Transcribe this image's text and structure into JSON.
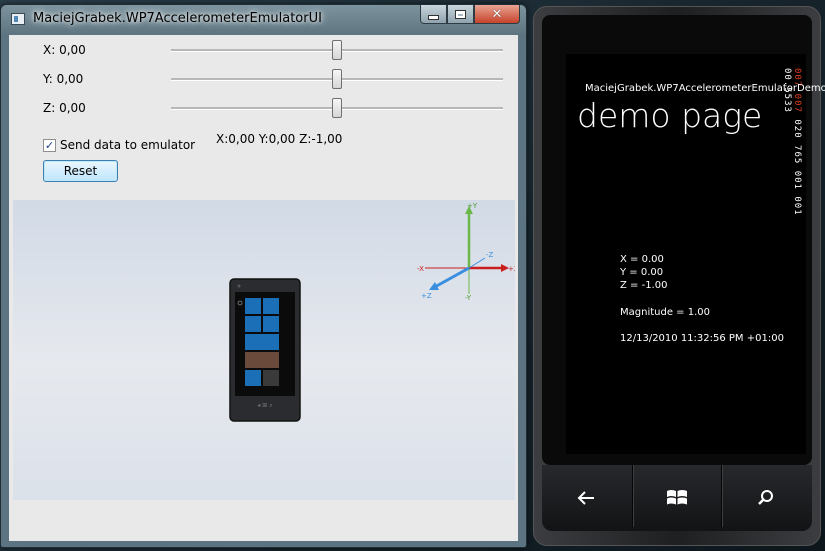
{
  "window": {
    "title": "MaciejGrabek.WP7AccelerometerEmulatorUI",
    "close_glyph": "✕",
    "icons": [
      "app-icon",
      "minimize-icon",
      "maximize-icon",
      "close-icon"
    ]
  },
  "sliders": [
    {
      "label": "X: 0,00",
      "value": 0.5
    },
    {
      "label": "Y: 0,00",
      "value": 0.5
    },
    {
      "label": "Z: 0,00",
      "value": 0.5
    }
  ],
  "send_checkbox": {
    "label": "Send data to emulator",
    "checked": true,
    "glyph": "✓"
  },
  "readout": "X:0,00 Y:0,00 Z:-1,00",
  "reset_label": "Reset",
  "axes": {
    "plus_y": "+Y",
    "minus_y": "-Y",
    "plus_x": "+X",
    "minus_x": "-X",
    "plus_z": "+Z",
    "minus_z": "-Z",
    "colors": {
      "x": "#c81e1e",
      "y": "#6ab84a",
      "z": "#3a8ee0"
    }
  },
  "emulator": {
    "app_title": "MaciejGrabek.WP7AccelerometerEmulatorDemo",
    "page_title": "demo page",
    "counters_red": "007 007",
    "counters": "020 765 001 001 00.5533",
    "x_line": "X = 0.00",
    "y_line": "Y = 0.00",
    "z_line": "Z = -1.00",
    "magnitude_line": "Magnitude = 1.00",
    "timestamp": "12/13/2010 11:32:56 PM +01:00",
    "hw_icons": [
      "back-arrow-icon",
      "windows-logo-icon",
      "search-icon"
    ]
  }
}
